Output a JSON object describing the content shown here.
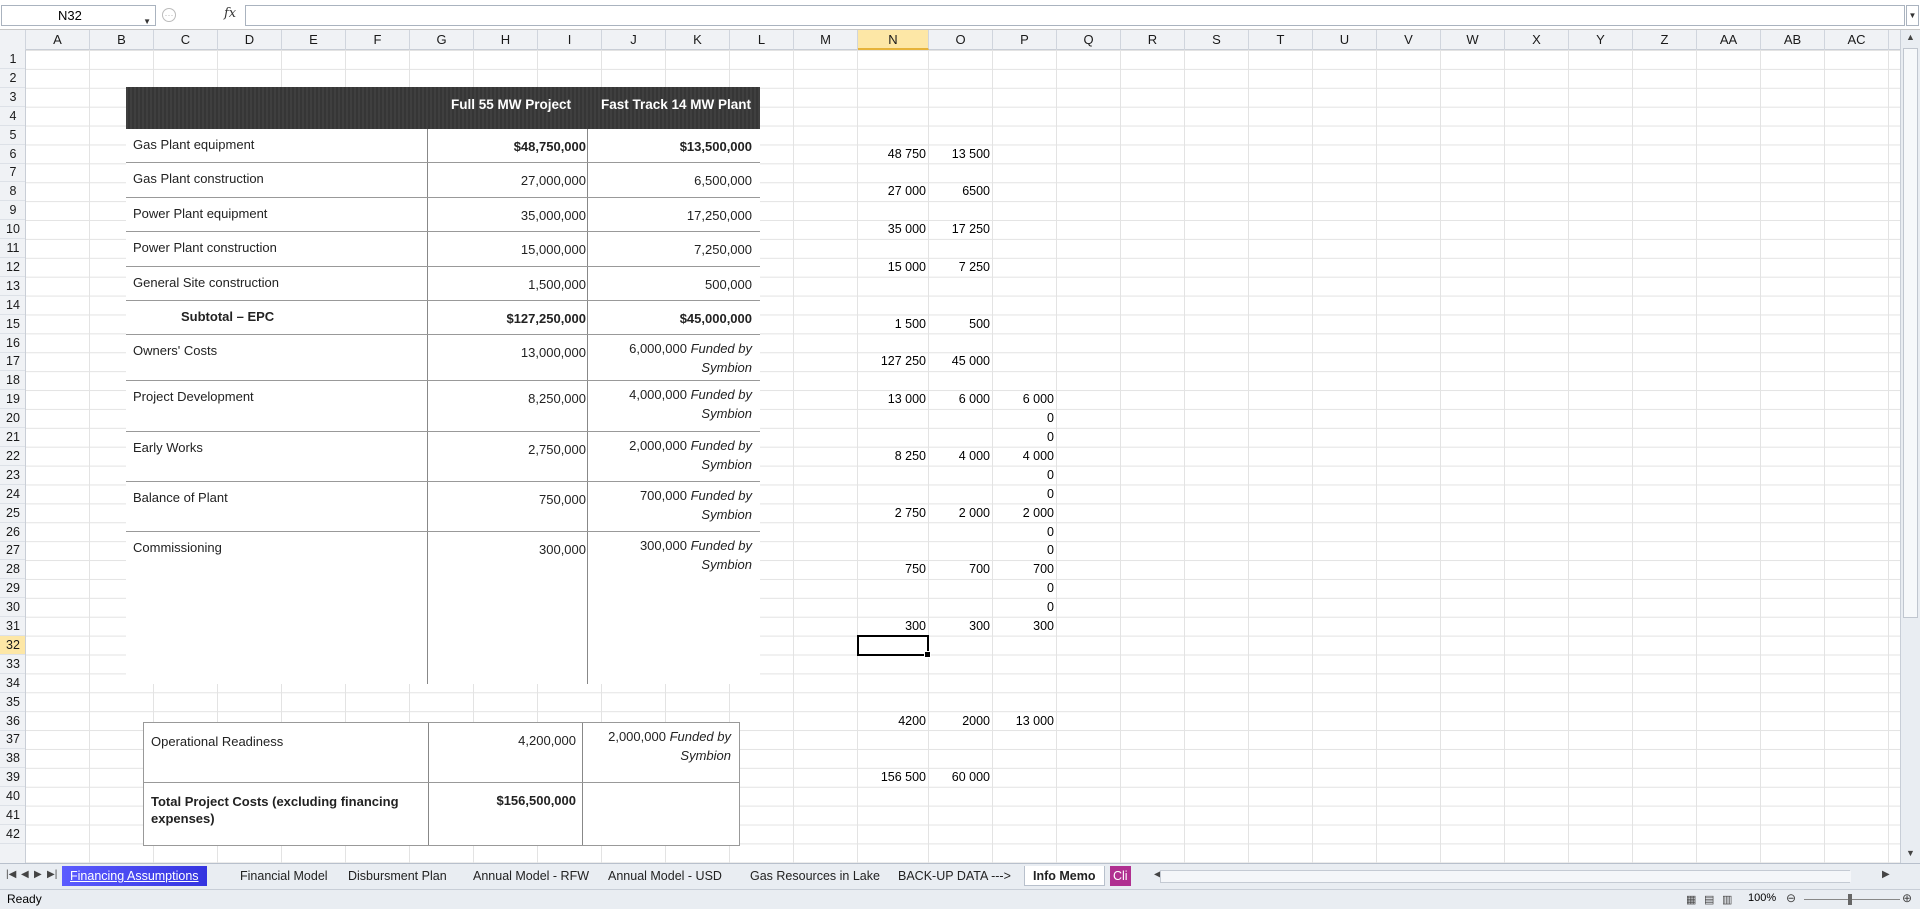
{
  "formula_bar": {
    "name_box": "N32",
    "fx_label": "fx",
    "formula": ""
  },
  "columns": [
    "A",
    "B",
    "C",
    "D",
    "E",
    "F",
    "G",
    "H",
    "I",
    "J",
    "K",
    "L",
    "M",
    "N",
    "O",
    "P",
    "Q",
    "R",
    "S",
    "T",
    "U",
    "V",
    "W",
    "X",
    "Y",
    "Z",
    "AA",
    "AB",
    "AC"
  ],
  "rows": [
    "1",
    "2",
    "3",
    "4",
    "5",
    "6",
    "7",
    "8",
    "9",
    "10",
    "11",
    "12",
    "13",
    "14",
    "15",
    "16",
    "17",
    "18",
    "19",
    "20",
    "21",
    "22",
    "23",
    "24",
    "25",
    "26",
    "27",
    "28",
    "29",
    "30",
    "31",
    "32",
    "33",
    "34",
    "35",
    "36",
    "37",
    "38",
    "39",
    "40",
    "41",
    "42"
  ],
  "selected": {
    "column": "N",
    "row": "32"
  },
  "embedded_table": {
    "col1_header": "Full 55 MW Project",
    "col2_header": "Fast Track 14 MW Plant",
    "rows": [
      {
        "label": "Gas Plant equipment",
        "v1": "$48,750,000",
        "v2": "$13,500,000",
        "note": ""
      },
      {
        "label": "Gas Plant construction",
        "v1": "27,000,000",
        "v2": "6,500,000",
        "note": ""
      },
      {
        "label": "Power Plant equipment",
        "v1": "35,000,000",
        "v2": "17,250,000",
        "note": ""
      },
      {
        "label": "Power Plant construction",
        "v1": "15,000,000",
        "v2": "7,250,000",
        "note": ""
      },
      {
        "label": "General Site construction",
        "v1": "1,500,000",
        "v2": "500,000",
        "note": ""
      },
      {
        "label": "Subtotal – EPC",
        "v1": "$127,250,000",
        "v2": "$45,000,000",
        "note": ""
      },
      {
        "label": "Owners' Costs",
        "v1": "13,000,000",
        "v2": "6,000,000",
        "note": "Funded by Symbion"
      },
      {
        "label": "Project Development",
        "v1": "8,250,000",
        "v2": "4,000,000",
        "note": "Funded by Symbion"
      },
      {
        "label": "Early Works",
        "v1": "2,750,000",
        "v2": "2,000,000",
        "note": "Funded by Symbion"
      },
      {
        "label": "Balance of Plant",
        "v1": "750,000",
        "v2": "700,000",
        "note": "Funded by Symbion"
      },
      {
        "label": "Commissioning",
        "v1": "300,000",
        "v2": "300,000",
        "note": "Funded by Symbion"
      }
    ],
    "table2": [
      {
        "label": "Operational Readiness",
        "v1": "4,200,000",
        "v2": "2,000,000",
        "note": "Funded by Symbion"
      },
      {
        "label": "Total Project Costs (excluding financing expenses)",
        "v1": "$156,500,000",
        "v2": "",
        "note": ""
      }
    ]
  },
  "cells": [
    {
      "col": "N",
      "row": 6,
      "value": "48 750"
    },
    {
      "col": "O",
      "row": 6,
      "value": "13 500"
    },
    {
      "col": "N",
      "row": 8,
      "value": "27 000"
    },
    {
      "col": "O",
      "row": 8,
      "value": "6500"
    },
    {
      "col": "N",
      "row": 10,
      "value": "35 000"
    },
    {
      "col": "O",
      "row": 10,
      "value": "17 250"
    },
    {
      "col": "N",
      "row": 12,
      "value": "15 000"
    },
    {
      "col": "O",
      "row": 12,
      "value": "7 250"
    },
    {
      "col": "N",
      "row": 15,
      "value": "1 500"
    },
    {
      "col": "O",
      "row": 15,
      "value": "500"
    },
    {
      "col": "N",
      "row": 17,
      "value": "127 250"
    },
    {
      "col": "O",
      "row": 17,
      "value": "45 000"
    },
    {
      "col": "N",
      "row": 19,
      "value": "13 000"
    },
    {
      "col": "O",
      "row": 19,
      "value": "6 000"
    },
    {
      "col": "P",
      "row": 19,
      "value": "6 000"
    },
    {
      "col": "P",
      "row": 20,
      "value": "0"
    },
    {
      "col": "P",
      "row": 21,
      "value": "0"
    },
    {
      "col": "N",
      "row": 22,
      "value": "8 250"
    },
    {
      "col": "O",
      "row": 22,
      "value": "4 000"
    },
    {
      "col": "P",
      "row": 22,
      "value": "4 000"
    },
    {
      "col": "P",
      "row": 23,
      "value": "0"
    },
    {
      "col": "P",
      "row": 24,
      "value": "0"
    },
    {
      "col": "N",
      "row": 25,
      "value": "2 750"
    },
    {
      "col": "O",
      "row": 25,
      "value": "2 000"
    },
    {
      "col": "P",
      "row": 25,
      "value": "2 000"
    },
    {
      "col": "P",
      "row": 26,
      "value": "0"
    },
    {
      "col": "P",
      "row": 27,
      "value": "0"
    },
    {
      "col": "N",
      "row": 28,
      "value": "750"
    },
    {
      "col": "O",
      "row": 28,
      "value": "700"
    },
    {
      "col": "P",
      "row": 28,
      "value": "700"
    },
    {
      "col": "P",
      "row": 29,
      "value": "0"
    },
    {
      "col": "P",
      "row": 30,
      "value": "0"
    },
    {
      "col": "N",
      "row": 31,
      "value": "300"
    },
    {
      "col": "O",
      "row": 31,
      "value": "300"
    },
    {
      "col": "P",
      "row": 31,
      "value": "300"
    },
    {
      "col": "N",
      "row": 36,
      "value": "4200"
    },
    {
      "col": "O",
      "row": 36,
      "value": "2000"
    },
    {
      "col": "P",
      "row": 36,
      "value": "13 000"
    },
    {
      "col": "N",
      "row": 39,
      "value": "156 500"
    },
    {
      "col": "O",
      "row": 39,
      "value": "60 000"
    }
  ],
  "sheet_tabs": [
    "Financing Assumptions",
    "Financial Model",
    "Disbursment Plan",
    "Annual Model - RFW",
    "Annual Model - USD",
    "Gas Resources in Lake",
    "BACK-UP DATA --->",
    "Info Memo",
    "Cli"
  ],
  "active_tab": "Info Memo",
  "status": {
    "text": "Ready",
    "zoom": "100%"
  }
}
